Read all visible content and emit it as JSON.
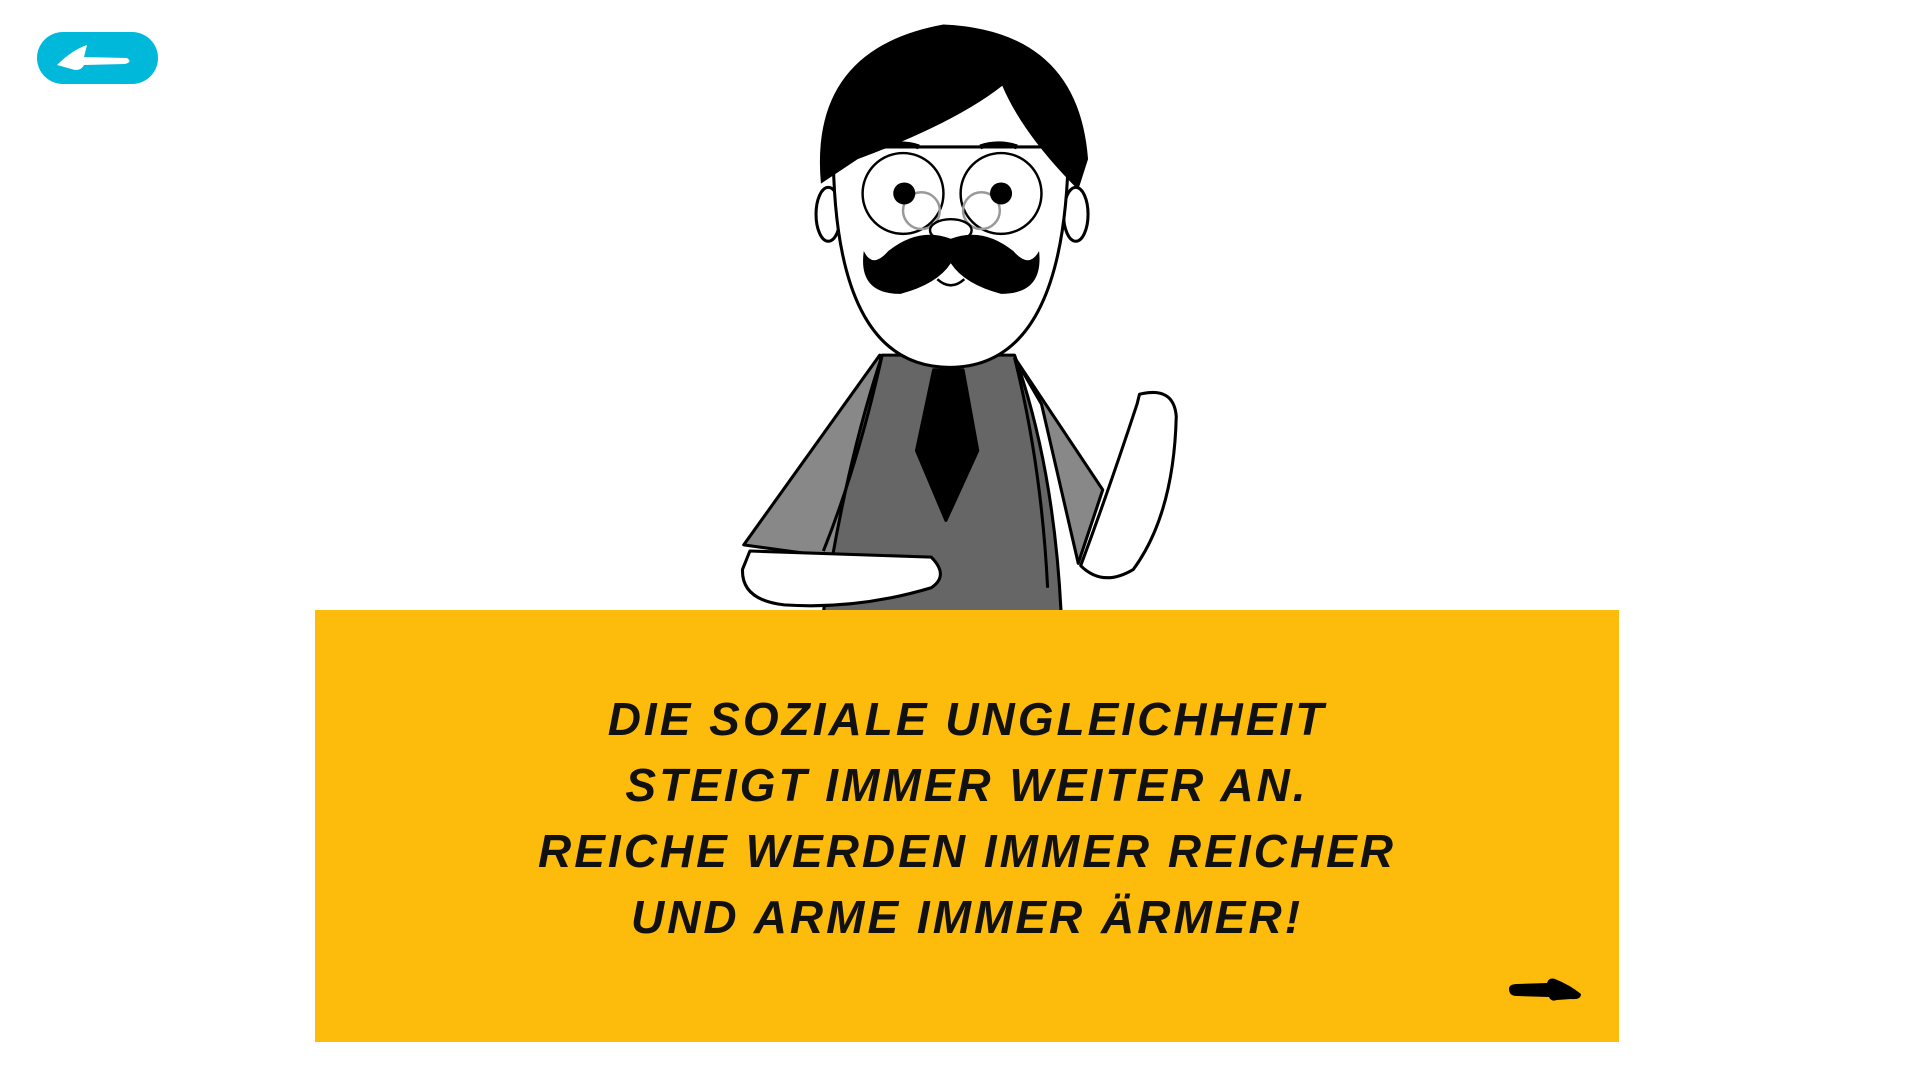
{
  "nav": {
    "back_icon": "arrow-left-icon",
    "next_icon": "arrow-right-icon"
  },
  "colors": {
    "accent": "#00B8D9",
    "panel": "#FDBB0B"
  },
  "message": {
    "lines": [
      "Die soziale Ungleichheit",
      "steigt immer weiter an.",
      "Reiche werden immer reicher",
      "und Arme immer ärmer!"
    ]
  }
}
